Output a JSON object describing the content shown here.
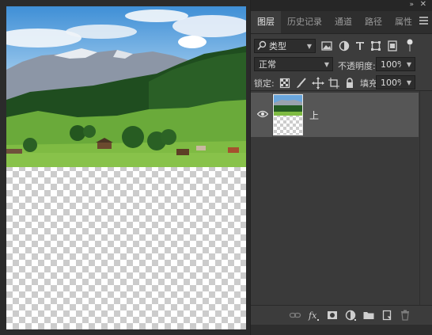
{
  "panel": {
    "tabs": [
      {
        "label": "图层",
        "active": true
      },
      {
        "label": "历史记录",
        "active": false
      },
      {
        "label": "通道",
        "active": false
      },
      {
        "label": "路径",
        "active": false
      },
      {
        "label": "属性",
        "active": false
      }
    ],
    "filter": {
      "label": "类型"
    },
    "blend_mode": "正常",
    "opacity": {
      "label": "不透明度:",
      "value": "100%"
    },
    "lock": {
      "label": "锁定:"
    },
    "fill": {
      "label": "填充:",
      "value": "100%"
    },
    "layers": [
      {
        "name": "上",
        "visible": true
      }
    ]
  },
  "colors": {
    "panel_bg": "#3c3c3c",
    "selected_layer": "#565656",
    "canvas_bg": "#2b2b2b"
  },
  "icons": [
    "double-chevron-collapse-icon",
    "close-icon",
    "panel-menu-icon",
    "search-icon",
    "image-filter-icon",
    "adjustment-filter-icon",
    "type-filter-icon",
    "shape-filter-icon",
    "smart-object-filter-icon",
    "filter-toggle-icon",
    "lock-transparent-icon",
    "lock-brush-icon",
    "lock-move-icon",
    "lock-artboard-icon",
    "lock-all-icon",
    "eye-icon",
    "link-icon",
    "fx-icon",
    "mask-icon",
    "adjustment-layer-icon",
    "folder-icon",
    "new-layer-icon",
    "trash-icon"
  ]
}
